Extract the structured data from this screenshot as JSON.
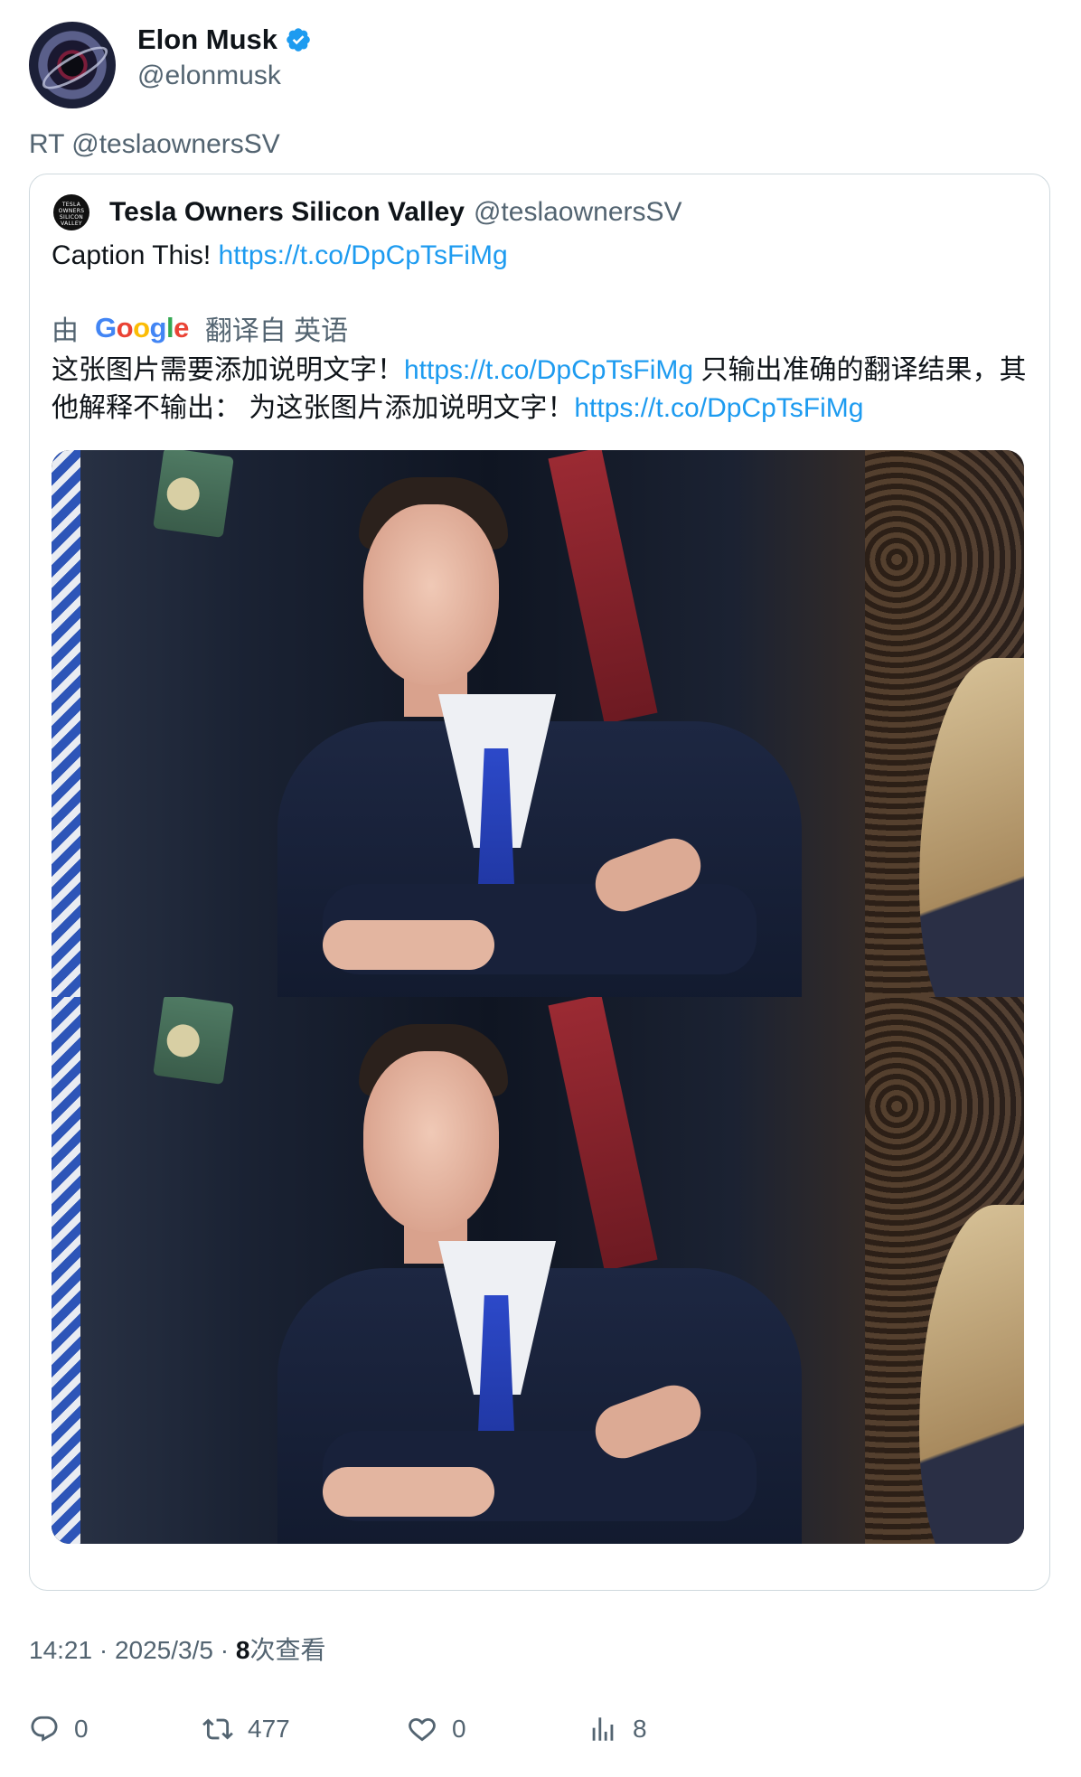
{
  "author": {
    "display_name": "Elon Musk",
    "handle": "@elonmusk",
    "verified_icon": "verified-badge-icon",
    "avatar_icon": "avatar-icon"
  },
  "retweet_line": "RT @teslaownersSV",
  "quoted": {
    "display_name": "Tesla Owners Silicon Valley",
    "handle": "@teslaownersSV",
    "avatar_text": "TESLA OWNERS SILICON VALLEY",
    "text_prefix": "Caption This! ",
    "link": "https://t.co/DpCpTsFiMg"
  },
  "translation": {
    "by_label": "由",
    "google_letters": [
      "G",
      "o",
      "o",
      "g",
      "l",
      "e"
    ],
    "from_label": "翻译自 英语",
    "part1": "这张图片需要添加说明文字！",
    "link1": "https://t.co/DpCpTsFiMg",
    "part2": " 只输出准确的翻译结果，其他解释不输出： 为这张图片添加说明文字！",
    "link2": "https://t.co/DpCpTsFiMg"
  },
  "meta": {
    "time": "14:21",
    "sep1": " · ",
    "date": "2025/3/5",
    "sep2": " · ",
    "views_count": "8",
    "views_label": "次查看"
  },
  "actions": {
    "reply_count": "0",
    "retweet_count": "477",
    "like_count": "0",
    "views_count": "8"
  },
  "colors": {
    "link": "#1d9bf0",
    "secondary_text": "#536471",
    "border": "#cfd9de",
    "verified": "#1d9bf0"
  }
}
